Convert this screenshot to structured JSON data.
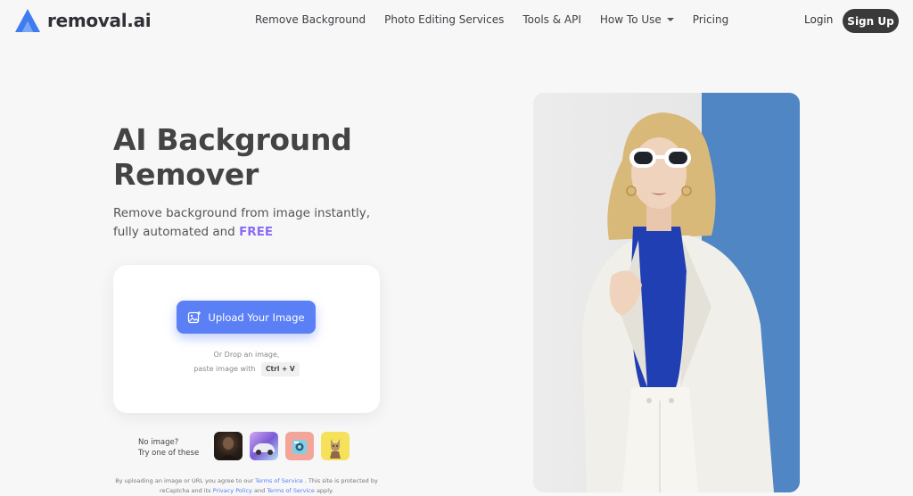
{
  "brand": {
    "name": "removal.ai",
    "accent": "#5b7ff5",
    "logo_color": "#3f7cf0"
  },
  "nav": {
    "links": [
      {
        "label": "Remove Background"
      },
      {
        "label": "Photo Editing Services"
      },
      {
        "label": "Tools & API"
      },
      {
        "label": "How To Use"
      },
      {
        "label": "Pricing"
      }
    ],
    "login": "Login",
    "signup": "Sign Up"
  },
  "hero": {
    "title": "AI Background Remover",
    "subtitle_line1": "Remove background from image instantly,",
    "subtitle_line2": "fully automated and",
    "subtitle_highlight": "FREE",
    "highlight_color": "#8a6cf3"
  },
  "upload": {
    "button_label": "Upload Your Image",
    "drop_line1": "Or Drop an image,",
    "drop_line2": "paste image with",
    "shortcut": "Ctrl + V"
  },
  "samples": {
    "label_line1": "No image?",
    "label_line2": "Try one of these"
  },
  "tos": {
    "prefix": "By uploading an image or URL you agree to our",
    "terms_link": "Terms of Service",
    "middle": ". This site is protected by reCaptcha and its",
    "privacy_link": "Privacy Policy",
    "and": "and",
    "terms_link2": "Terms of Service",
    "suffix": "apply."
  }
}
